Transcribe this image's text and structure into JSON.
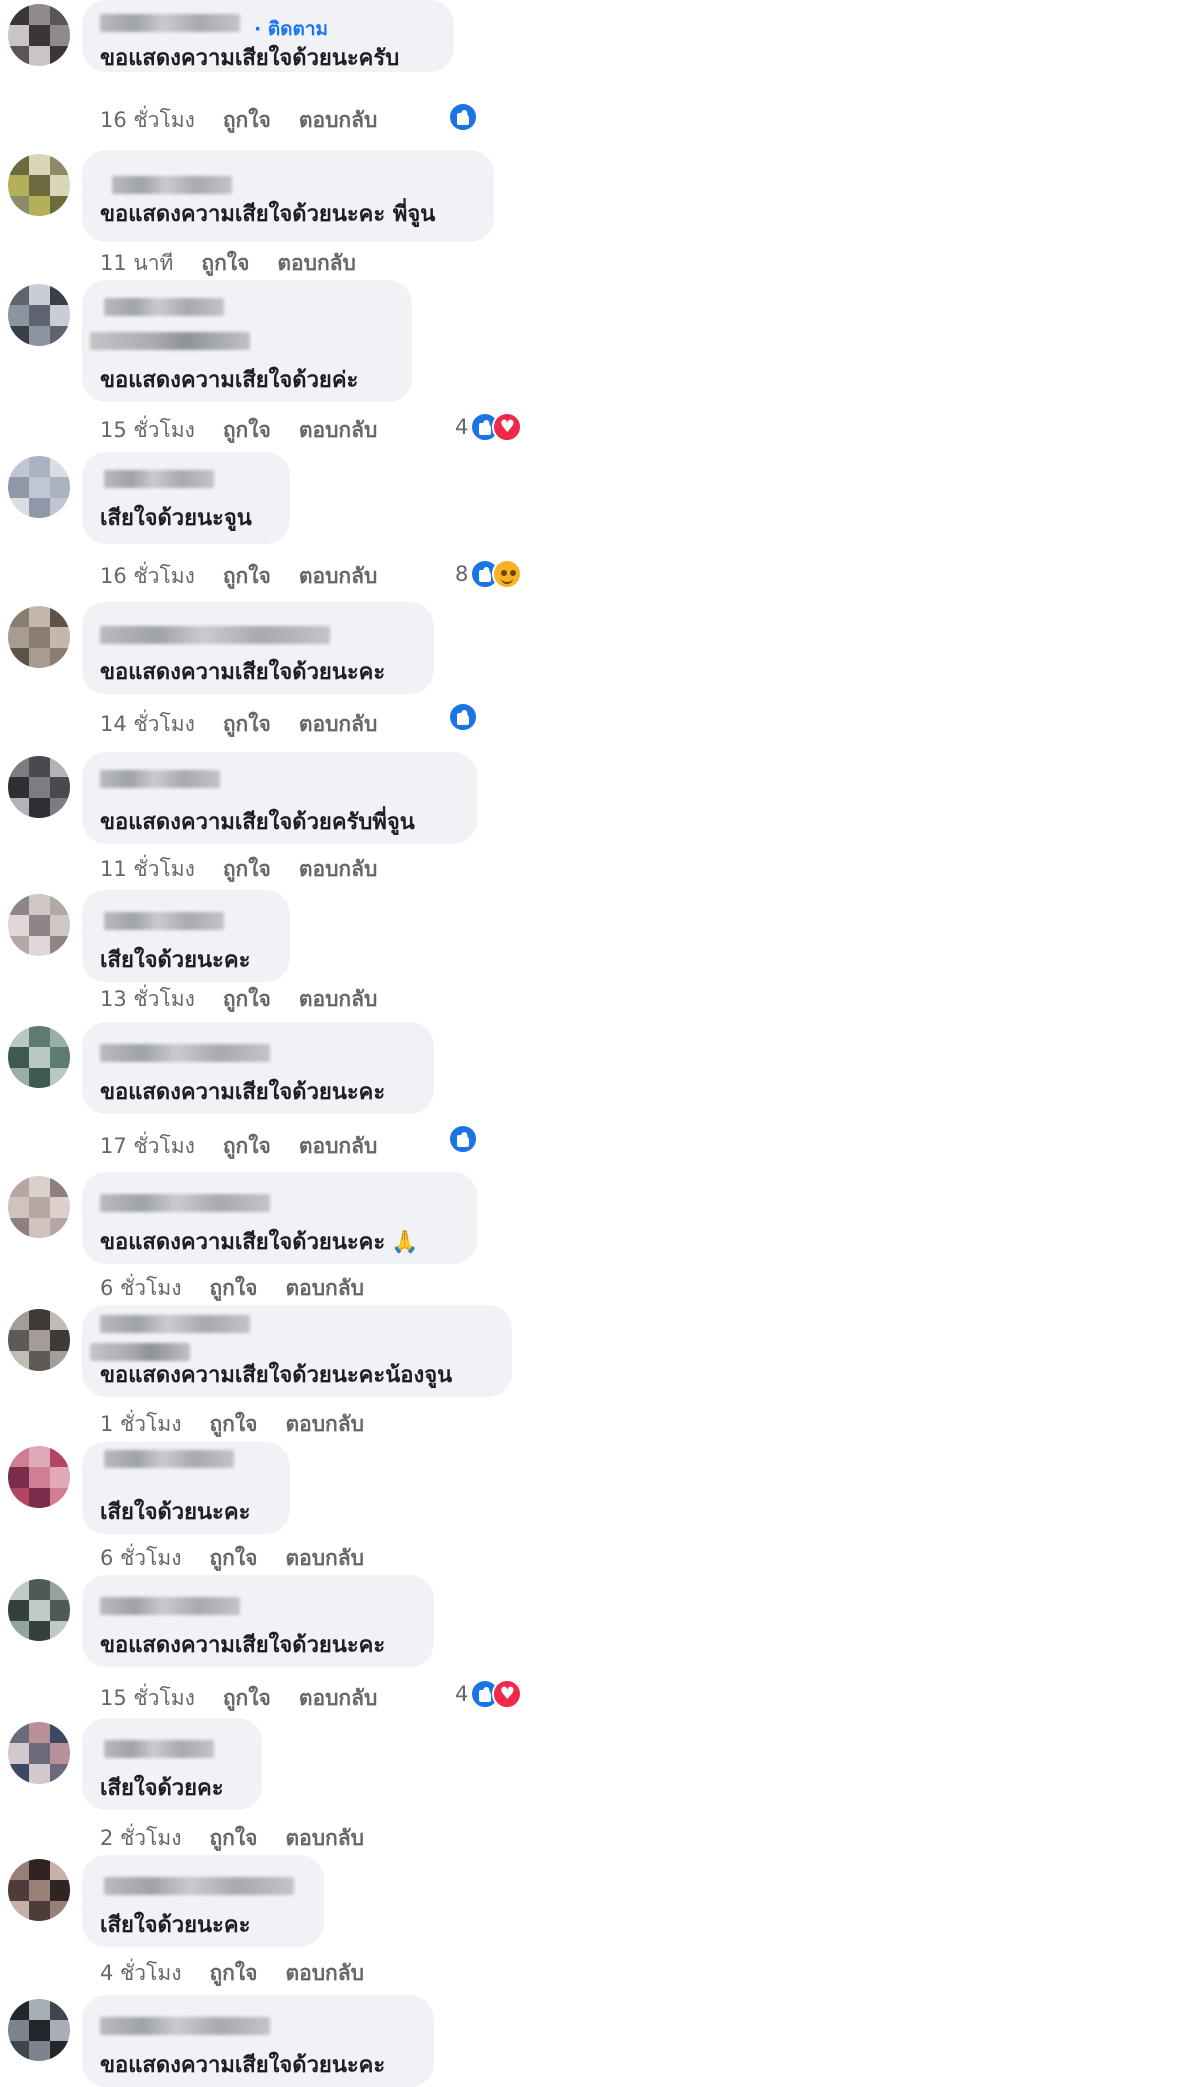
{
  "actions": {
    "like": "ถูกใจ",
    "reply": "ตอบกลับ"
  },
  "follow_label": "ติดตาม",
  "colors": {
    "bubble": "#f0f2f5",
    "meta": "#65676b",
    "link": "#1877f2",
    "like": "#1b74e4",
    "love": "#f02849",
    "care": "#f7b125"
  },
  "comments": [
    {
      "text": "ขอแสดงความเสียใจด้วยนะครับ",
      "time": "16 ชั่วโมง",
      "reaction_count": "",
      "reactions": [
        "like-icon"
      ]
    },
    {
      "text": "ขอแสดงความเสียใจด้วยนะคะ พี่จูน",
      "time": "11 นาที",
      "reaction_count": "",
      "reactions": []
    },
    {
      "text": "ขอแสดงความเสียใจด้วยค่ะ",
      "time": "15 ชั่วโมง",
      "reaction_count": "4",
      "reactions": [
        "like-icon",
        "love-icon"
      ]
    },
    {
      "text": "เสียใจด้วยนะจูน",
      "time": "16 ชั่วโมง",
      "reaction_count": "8",
      "reactions": [
        "like-icon",
        "care-icon"
      ]
    },
    {
      "text": "ขอแสดงความเสียใจด้วยนะคะ",
      "time": "14 ชั่วโมง",
      "reaction_count": "",
      "reactions": [
        "like-icon"
      ]
    },
    {
      "text": "ขอแสดงความเสียใจด้วยครับพี่จูน",
      "time": "11 ชั่วโมง",
      "reaction_count": "",
      "reactions": []
    },
    {
      "text": "เสียใจด้วยนะคะ",
      "time": "13 ชั่วโมง",
      "reaction_count": "",
      "reactions": []
    },
    {
      "text": "ขอแสดงความเสียใจด้วยนะคะ",
      "time": "17 ชั่วโมง",
      "reaction_count": "",
      "reactions": [
        "like-icon"
      ]
    },
    {
      "text": "ขอแสดงความเสียใจด้วยนะคะ",
      "emoji": "🙏",
      "time": "6 ชั่วโมง",
      "reaction_count": "",
      "reactions": []
    },
    {
      "text": "ขอแสดงความเสียใจด้วยนะคะน้องจูน",
      "time": "1 ชั่วโมง",
      "reaction_count": "",
      "reactions": []
    },
    {
      "text": "เสียใจด้วยนะคะ",
      "time": "6 ชั่วโมง",
      "reaction_count": "",
      "reactions": []
    },
    {
      "text": "ขอแสดงความเสียใจด้วยนะคะ",
      "time": "15 ชั่วโมง",
      "reaction_count": "4",
      "reactions": [
        "like-icon",
        "love-icon"
      ]
    },
    {
      "text": "เสียใจด้วยคะ",
      "time": "2 ชั่วโมง",
      "reaction_count": "",
      "reactions": []
    },
    {
      "text": "เสียใจด้วยนะคะ",
      "time": "4 ชั่วโมง",
      "reaction_count": "",
      "reactions": []
    },
    {
      "text": "ขอแสดงความเสียใจด้วยนะคะ",
      "time": "",
      "reaction_count": "",
      "reactions": []
    }
  ]
}
